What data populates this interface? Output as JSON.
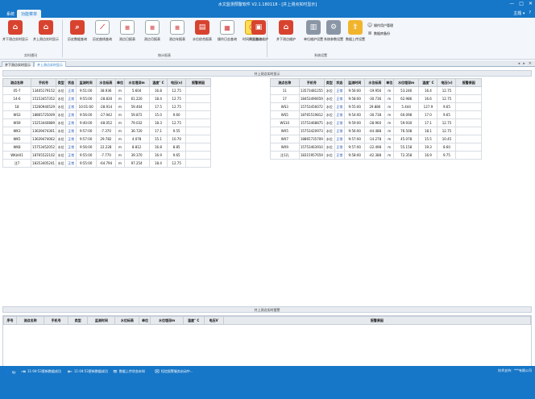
{
  "window": {
    "title": "水文监测预警软件 V2.1.180118 - [井上测点实时显示]",
    "buttons": [
      "—",
      "□",
      "✕"
    ]
  },
  "menu": {
    "tabs": [
      "系统",
      "功能菜单"
    ],
    "active": "功能菜单",
    "right": [
      "主题 ▾",
      "?"
    ]
  },
  "ribbon": {
    "groups": [
      {
        "label": "实时通讯",
        "buttons": [
          "井下测点实时显示",
          "井上测点实时显示"
        ]
      },
      {
        "label": "统计报表",
        "buttons": [
          "历史数据查询",
          "历史曲线查询",
          "测点日报表",
          "测点月报表",
          "测点年报表",
          "水位综合报表",
          "操作日志查询",
          "时间间隔查询"
        ]
      },
      {
        "label": "系统设置",
        "buttons": [
          "井上测点维护",
          "井下测点维护",
          "单位维护设置",
          "系统参数设置",
          "数据上传设置"
        ]
      }
    ],
    "side_links": [
      "操作用户管理",
      "数据库备份"
    ]
  },
  "doc_tabs": [
    "井下测点实时显示",
    "井上测点实时显示"
  ],
  "upper_panel_title": "井上测点实时显示",
  "lower_panel_title": "井上测点实时报警",
  "columns": [
    "测点名称",
    "手机号",
    "类型",
    "状态",
    "监测时间",
    "水位标高",
    "单位",
    "水位埋深m",
    "温度° C",
    "电压(v)",
    "报警原因"
  ],
  "left_rows": [
    [
      "05-7",
      "13405179152",
      "水位",
      "正常",
      "9:51:00",
      "38.936",
      "m",
      "5.604",
      "16.8",
      "12.75",
      ""
    ],
    [
      "14-6",
      "15153457352",
      "水位",
      "正常",
      "9:55:00",
      "-28.830",
      "m",
      "61.220",
      "18.4",
      "12.75",
      ""
    ],
    [
      "18",
      "15260940529",
      "水位",
      "正常",
      "10:01:00",
      "-28.914",
      "m",
      "59.404",
      "17.5",
      "12.75",
      ""
    ],
    [
      "WS3",
      "18865725009",
      "水位",
      "正常",
      "9:56:00",
      "-27.942",
      "m",
      "59.872",
      "15.0",
      "9.60",
      ""
    ],
    [
      "WS9",
      "15253440889",
      "水位",
      "正常",
      "9:40:00",
      "-48.052",
      "m",
      "79.032",
      "18.3",
      "12.75",
      ""
    ],
    [
      "WK3",
      "13639474361",
      "水位",
      "正常",
      "9:57:00",
      "-7.370",
      "m",
      "36.720",
      "17.1",
      "9.55",
      ""
    ],
    [
      "WK5",
      "13639474062",
      "水位",
      "正常",
      "9:57:00",
      "29.782",
      "m",
      "4.078",
      "15.1",
      "10.70",
      ""
    ],
    [
      "WK8",
      "15753452052",
      "水位",
      "正常",
      "9:56:00",
      "22.228",
      "m",
      "8.812",
      "16.8",
      "8.85",
      ""
    ],
    [
      "WK补01",
      "18765522102",
      "水位",
      "正常",
      "9:55:00",
      "-7.770",
      "m",
      "39.370",
      "16.9",
      "9.65",
      ""
    ],
    [
      "注7",
      "18353405241",
      "水位",
      "正常",
      "9:55:00",
      "-64.794",
      "m",
      "97.254",
      "18.4",
      "12.75",
      ""
    ]
  ],
  "right_rows": [
    [
      "11",
      "13573481255",
      "水位",
      "正常",
      "9:56:00",
      "-19.956",
      "m",
      "53.246",
      "16.4",
      "12.75",
      ""
    ],
    [
      "17",
      "18453490659",
      "水位",
      "正常",
      "9:58:00",
      "-30.736",
      "m",
      "62.986",
      "16.6",
      "12.75",
      ""
    ],
    [
      "WS3",
      "15753456072",
      "水位",
      "正常",
      "9:55:00",
      "29.886",
      "m",
      "5.444",
      "127.9",
      "9.65",
      ""
    ],
    [
      "WS5",
      "18765519812",
      "水位",
      "正常",
      "9:54:00",
      "-30.738",
      "m",
      "60.098",
      "17.0",
      "9.65",
      ""
    ],
    [
      "WS10",
      "15753468875",
      "水位",
      "正常",
      "9:59:00",
      "-28.960",
      "m",
      "59.930",
      "17.1",
      "12.75",
      ""
    ],
    [
      "WX5",
      "15753420973",
      "水位",
      "正常",
      "9:56:00",
      "-44.488",
      "m",
      "76.508",
      "18.1",
      "12.75",
      ""
    ],
    [
      "WX7",
      "18865735709",
      "水位",
      "正常",
      "9:57:00",
      "-14.278",
      "m",
      "45.078",
      "15.5",
      "10.45",
      ""
    ],
    [
      "WX9",
      "15753463910",
      "水位",
      "正常",
      "9:57:00",
      "-22.498",
      "m",
      "55.158",
      "19.3",
      "8.60",
      ""
    ],
    [
      "注1孔",
      "18315957659",
      "水位",
      "正常",
      "9:58:00",
      "-42.388",
      "m",
      "72.358",
      "16.9",
      "9.75",
      ""
    ]
  ],
  "alarm_columns": [
    "序号",
    "测点名称",
    "手机号",
    "类型",
    "监测时间",
    "水位标高",
    "单位",
    "水位埋深m",
    "温度° C",
    "电压V",
    "报警原因"
  ],
  "status": {
    "user": "qy",
    "items": [
      "11:04:53更新数据成功",
      "11:04:53更新数据成功",
      "数据上传状态未知",
      "短信报警服务启动中..."
    ],
    "right": "技术支持：***有限公司"
  }
}
